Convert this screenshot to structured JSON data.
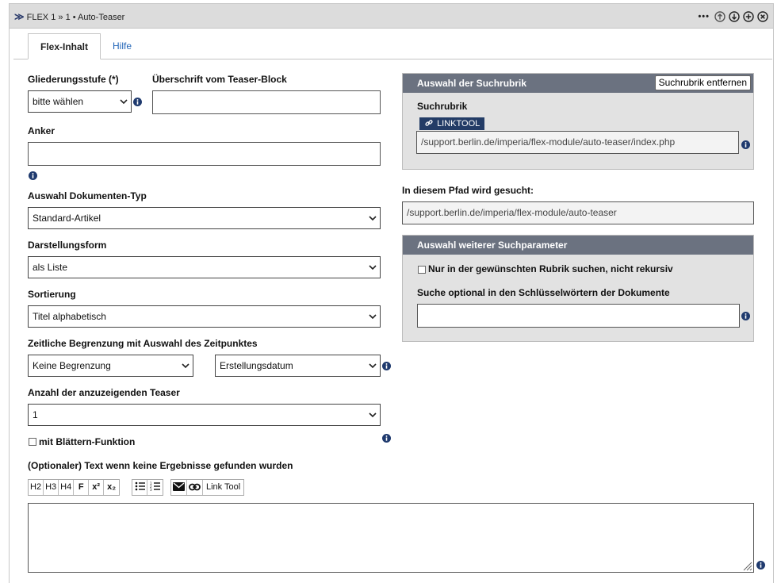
{
  "header": {
    "breadcrumb_part1": "FLEX 1",
    "breadcrumb_sep": "»",
    "breadcrumb_part2": "1 • Auto-Teaser",
    "more_label": "•••"
  },
  "tabs": [
    {
      "label": "Flex-Inhalt",
      "active": true
    },
    {
      "label": "Hilfe",
      "active": false
    }
  ],
  "form": {
    "gliederung": {
      "label": "Gliederungsstufe (*)",
      "value": "bitte wählen"
    },
    "ueberschrift": {
      "label": "Überschrift vom Teaser-Block",
      "value": ""
    },
    "anker": {
      "label": "Anker",
      "value": ""
    },
    "doktyp": {
      "label": "Auswahl Dokumenten-Typ",
      "value": "Standard-Artikel"
    },
    "darstellung": {
      "label": "Darstellungsform",
      "value": "als Liste"
    },
    "sortierung": {
      "label": "Sortierung",
      "value": "Titel alphabetisch"
    },
    "zeit": {
      "label": "Zeitliche Begrenzung mit Auswahl des Zeitpunktes",
      "value1": "Keine Begrenzung",
      "value2": "Erstellungsdatum"
    },
    "anzahl": {
      "label": "Anzahl der anzuzeigenden Teaser",
      "value": "1"
    },
    "blaettern": {
      "label": "mit Blättern-Funktion",
      "checked": false
    },
    "optionaltext": {
      "label": "(Optionaler) Text wenn keine Ergebnisse gefunden wurden"
    }
  },
  "toolbar": {
    "h2": "H2",
    "h3": "H3",
    "h4": "H4",
    "bold": "F",
    "sup": "x²",
    "sub": "x₂",
    "linktool": "Link Tool"
  },
  "suchrubrik": {
    "title": "Auswahl der Suchrubrik",
    "remove_button": "Suchrubrik entfernen",
    "label": "Suchrubrik",
    "linktool_button": "LINKTOOL",
    "value": "/support.berlin.de/imperia/flex-module/auto-teaser/index.php"
  },
  "pfad": {
    "label": "In diesem Pfad wird gesucht:",
    "value": "/support.berlin.de/imperia/flex-module/auto-teaser"
  },
  "weitere": {
    "title": "Auswahl weiterer Suchparameter",
    "checkbox_label": "Nur in der gewünschten Rubrik suchen, nicht rekursiv",
    "checked": false,
    "keywords_label": "Suche optional in den Schlüsselwörtern der Dokumente",
    "keywords_value": ""
  },
  "colors": {
    "accent_blue": "#2366b8",
    "panel_header": "#6b7280",
    "info_icon": "#1f3a6e",
    "linktool_bg": "#233c66"
  }
}
